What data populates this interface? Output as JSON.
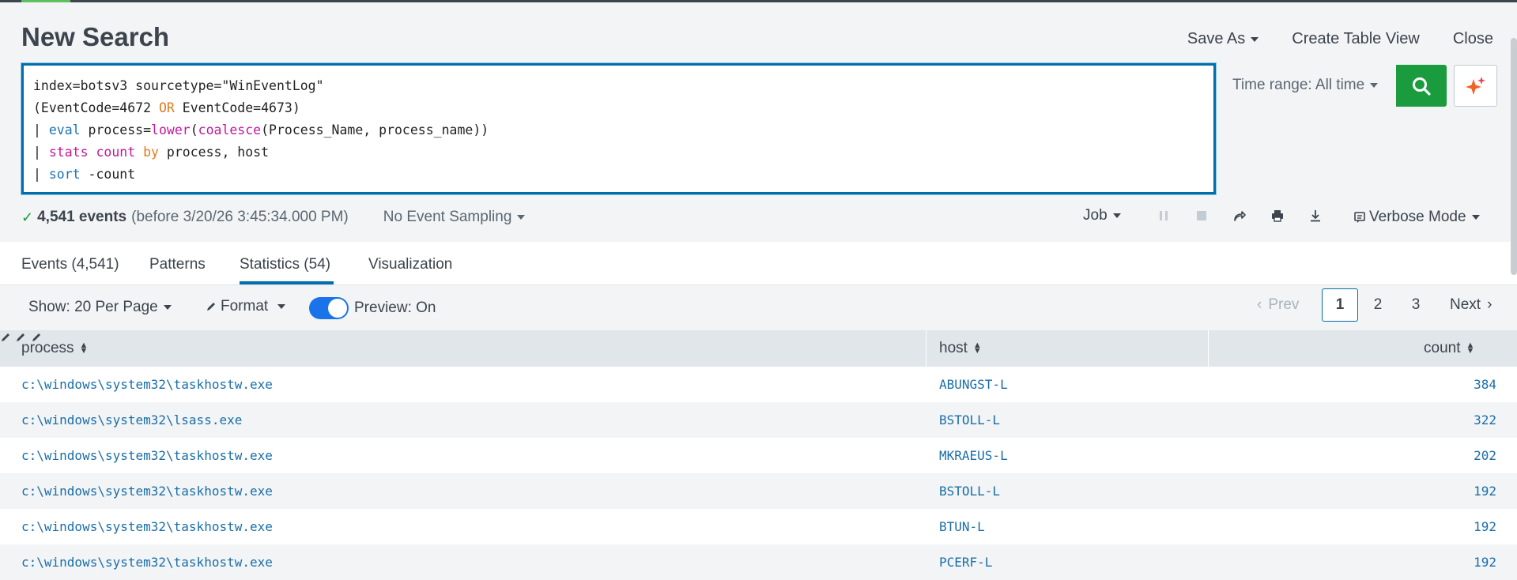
{
  "header": {
    "title": "New Search",
    "save_as": "Save As",
    "create_table_view": "Create Table View",
    "close": "Close"
  },
  "search": {
    "lines": [
      "index=botsv3 sourcetype=\"WinEventLog\"",
      "(EventCode=4672 OR EventCode=4673)",
      "| eval process=lower(coalesce(Process_Name, process_name))",
      "| stats count by process, host",
      "| sort -count"
    ],
    "time_range": "Time range: All time"
  },
  "status": {
    "events": "4,541 events",
    "before": "(before 3/20/26 3:45:34.000 PM)",
    "sampling": "No Event Sampling",
    "job": "Job",
    "mode": "Verbose Mode"
  },
  "tabs": [
    {
      "label": "Events (4,541)"
    },
    {
      "label": "Patterns"
    },
    {
      "label": "Statistics (54)"
    },
    {
      "label": "Visualization"
    }
  ],
  "toolbar": {
    "show": "Show: 20 Per Page",
    "format": "Format",
    "preview": "Preview: On"
  },
  "pager": {
    "prev": "Prev",
    "pages": [
      "1",
      "2",
      "3"
    ],
    "next": "Next"
  },
  "table": {
    "columns": [
      "process",
      "host",
      "count"
    ],
    "rows": [
      {
        "process": "c:\\windows\\system32\\taskhostw.exe",
        "host": "ABUNGST-L",
        "count": "384"
      },
      {
        "process": "c:\\windows\\system32\\lsass.exe",
        "host": "BSTOLL-L",
        "count": "322"
      },
      {
        "process": "c:\\windows\\system32\\taskhostw.exe",
        "host": "MKRAEUS-L",
        "count": "202"
      },
      {
        "process": "c:\\windows\\system32\\taskhostw.exe",
        "host": "BSTOLL-L",
        "count": "192"
      },
      {
        "process": "c:\\windows\\system32\\taskhostw.exe",
        "host": "BTUN-L",
        "count": "192"
      },
      {
        "process": "c:\\windows\\system32\\taskhostw.exe",
        "host": "PCERF-L",
        "count": "192"
      }
    ]
  },
  "colors": {
    "accent": "#006eaa",
    "search_button": "#1a9c3e",
    "link": "#1a6ea8"
  }
}
